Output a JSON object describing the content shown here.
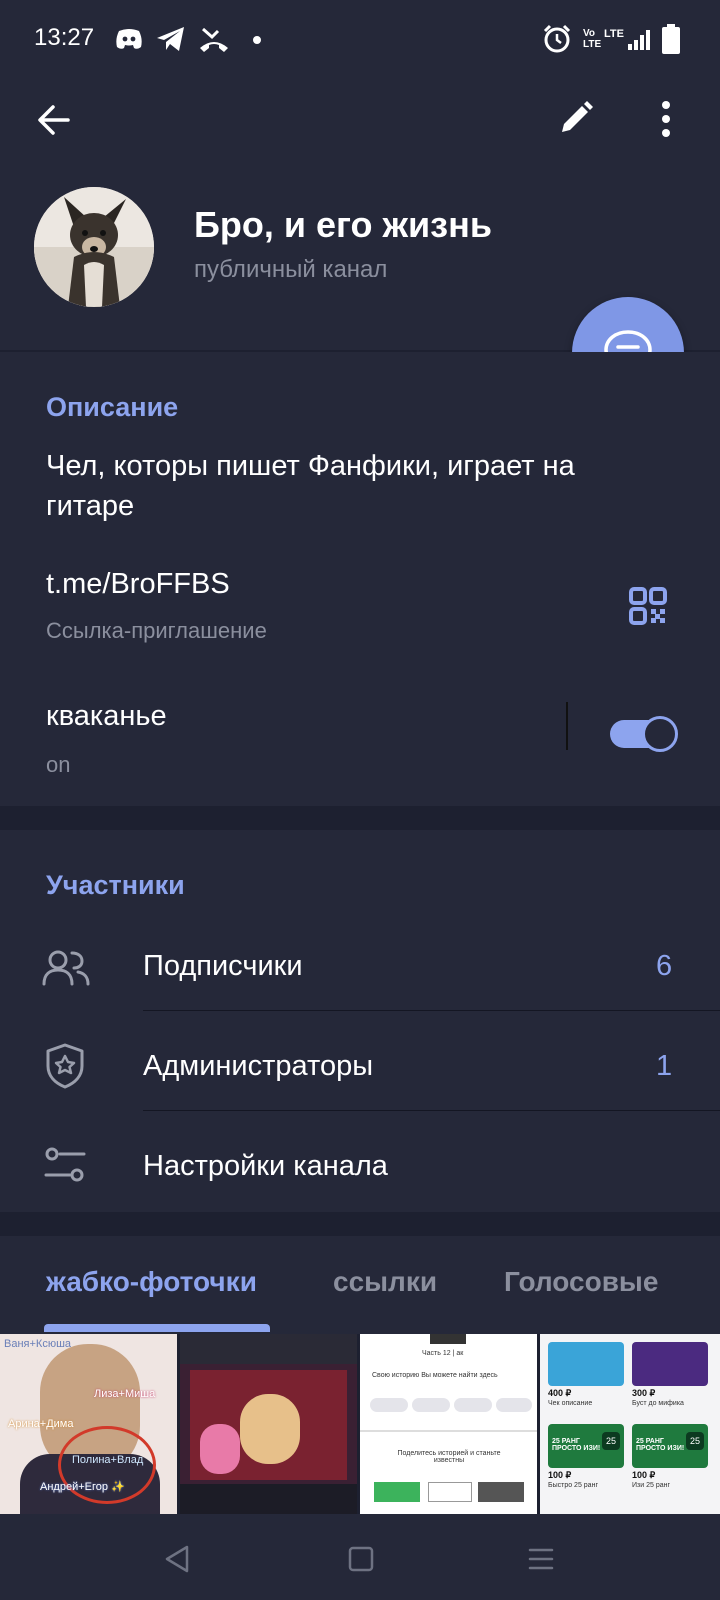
{
  "status_bar": {
    "time": "13:27",
    "left_icons": [
      "discord-icon",
      "telegram-icon",
      "missed-call-icon",
      "dot-icon"
    ],
    "right_icons": [
      "alarm-icon",
      "volte-icon",
      "lte-signal-icon",
      "battery-icon"
    ],
    "volte_label": "Vo LTE",
    "lte_label": "LTE"
  },
  "toolbar": {
    "back_icon": "arrow-left-icon",
    "edit_icon": "pencil-icon",
    "more_icon": "more-vertical-icon"
  },
  "channel": {
    "name": "Бро, и его жизнь",
    "type": "публичный канал"
  },
  "fab_icon": "message-icon",
  "description_section": {
    "title": "Описание",
    "text": "Чел, которы пишет Фанфики, играет на гитаре",
    "link": "t.me/BroFFBS",
    "link_label": "Ссылка-приглашение",
    "toggle_label": "кваканье",
    "toggle_value": "on",
    "toggle_on": true
  },
  "members_section": {
    "title": "Участники",
    "items": [
      {
        "label": "Подписчики",
        "count": "6",
        "icon": "users-icon"
      },
      {
        "label": "Администраторы",
        "count": "1",
        "icon": "admin-shield-icon"
      },
      {
        "label": "Настройки канала",
        "count": "",
        "icon": "settings-sliders-icon"
      }
    ]
  },
  "media_tabs": [
    "жабко-фоточки",
    "ссылки",
    "Голосовые"
  ],
  "media_thumbs": {
    "thumb1_labels": [
      "Ваня+Ксюша",
      "Лиза+Миша",
      "Арина+Дима",
      "Полина+Влад",
      "Андрей+Егор ✨"
    ],
    "thumb3_labels": [
      "Часть 12 | ак",
      "Свою историю Вы можете найти здесь",
      "Поделитесь историей и станьте известны"
    ],
    "thumb4_labels": [
      "400 ₽",
      "Чек описание",
      "300 ₽",
      "Буст до мифика",
      "100 ₽",
      "Быстро 25 ранг",
      "100 ₽",
      "Изи 25 ранг",
      "25 РАНГ ПРОСТО ИЗИ!",
      "25"
    ]
  },
  "colors": {
    "accent": "#8da4ee",
    "background": "#1d2030",
    "surface": "#252839",
    "fab": "#7f97e6",
    "subtext": "#8b8f9e"
  },
  "nav": [
    "back-triangle-icon",
    "home-square-icon",
    "recents-menu-icon"
  ]
}
